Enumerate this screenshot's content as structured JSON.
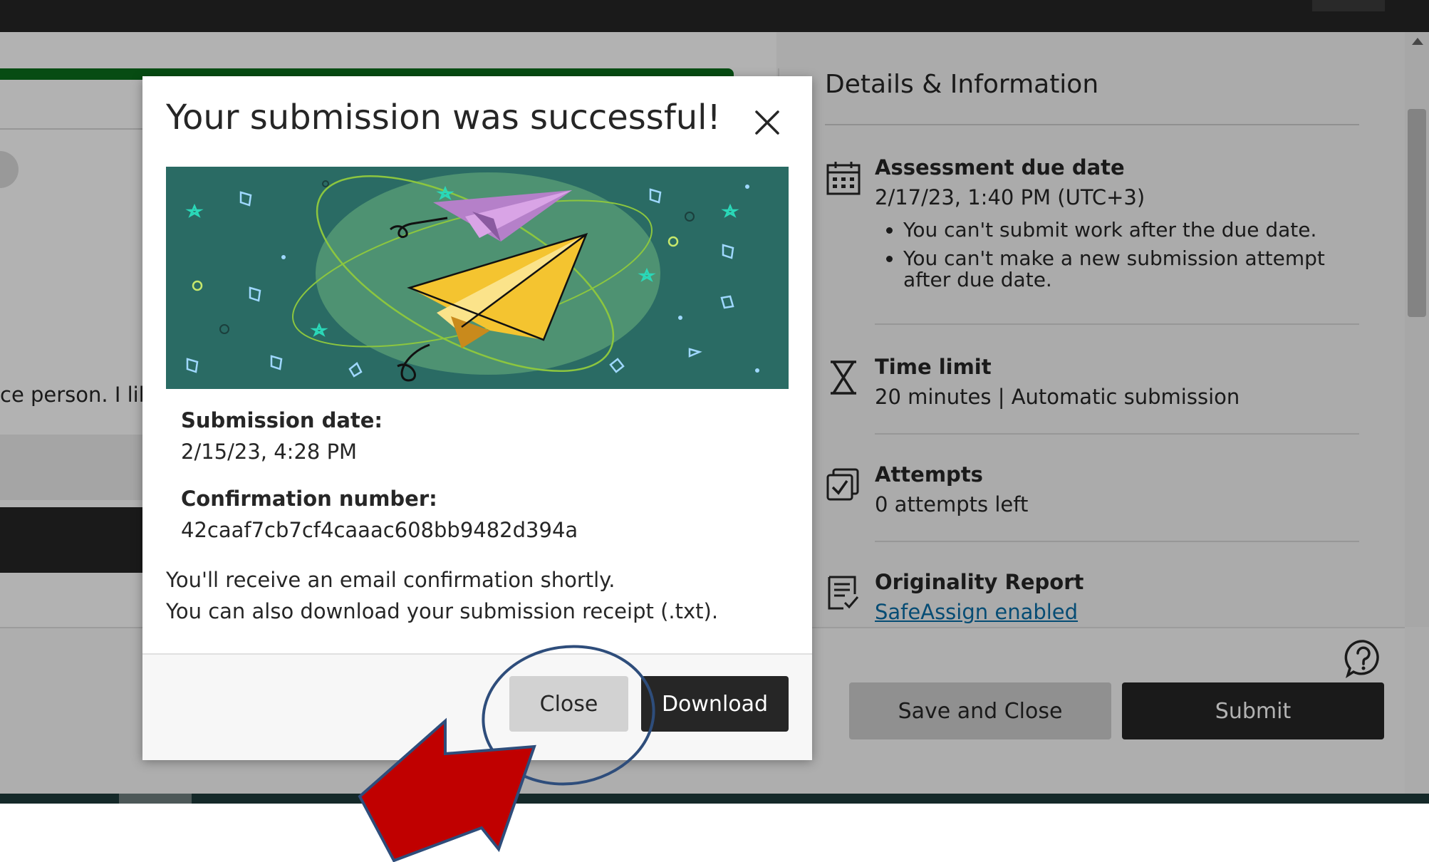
{
  "background_page": {
    "partial_text": "ce person. I like"
  },
  "details": {
    "title": "Details & Information",
    "due_date": {
      "icon": "calendar-icon",
      "label": "Assessment due date",
      "value": "2/17/23, 1:40 PM (UTC+3)",
      "notes": [
        "You can't submit work after the due date.",
        "You can't make a new submission attempt after due date."
      ]
    },
    "time_limit": {
      "icon": "hourglass-icon",
      "label": "Time limit",
      "value": "20 minutes | Automatic submission"
    },
    "attempts": {
      "icon": "attempts-icon",
      "label": "Attempts",
      "value": "0 attempts left"
    },
    "originality": {
      "icon": "report-icon",
      "label": "Originality Report",
      "link": "SafeAssign enabled"
    }
  },
  "footer": {
    "save_close_label": "Save and Close",
    "submit_label": "Submit",
    "help_icon": "help-icon"
  },
  "modal": {
    "title": "Your submission was successful!",
    "close_icon": "close-icon",
    "submission_date_label": "Submission date:",
    "submission_date": "2/15/23, 4:28 PM",
    "confirmation_label": "Confirmation number:",
    "confirmation_number": "42caaf7cb7cf4caaac608bb9482d394a",
    "message_line1": "You'll receive an email confirmation shortly.",
    "message_line2": "You can also download your submission receipt (.txt).",
    "close_label": "Close",
    "download_label": "Download"
  },
  "colors": {
    "progress_green": "#0b6e1c",
    "banner_teal": "#2a6b64",
    "primary_dark": "#262626",
    "link_blue": "#0a6ea6",
    "annotation_arrow": "#c00000",
    "annotation_ellipse": "#2e4d7b"
  }
}
